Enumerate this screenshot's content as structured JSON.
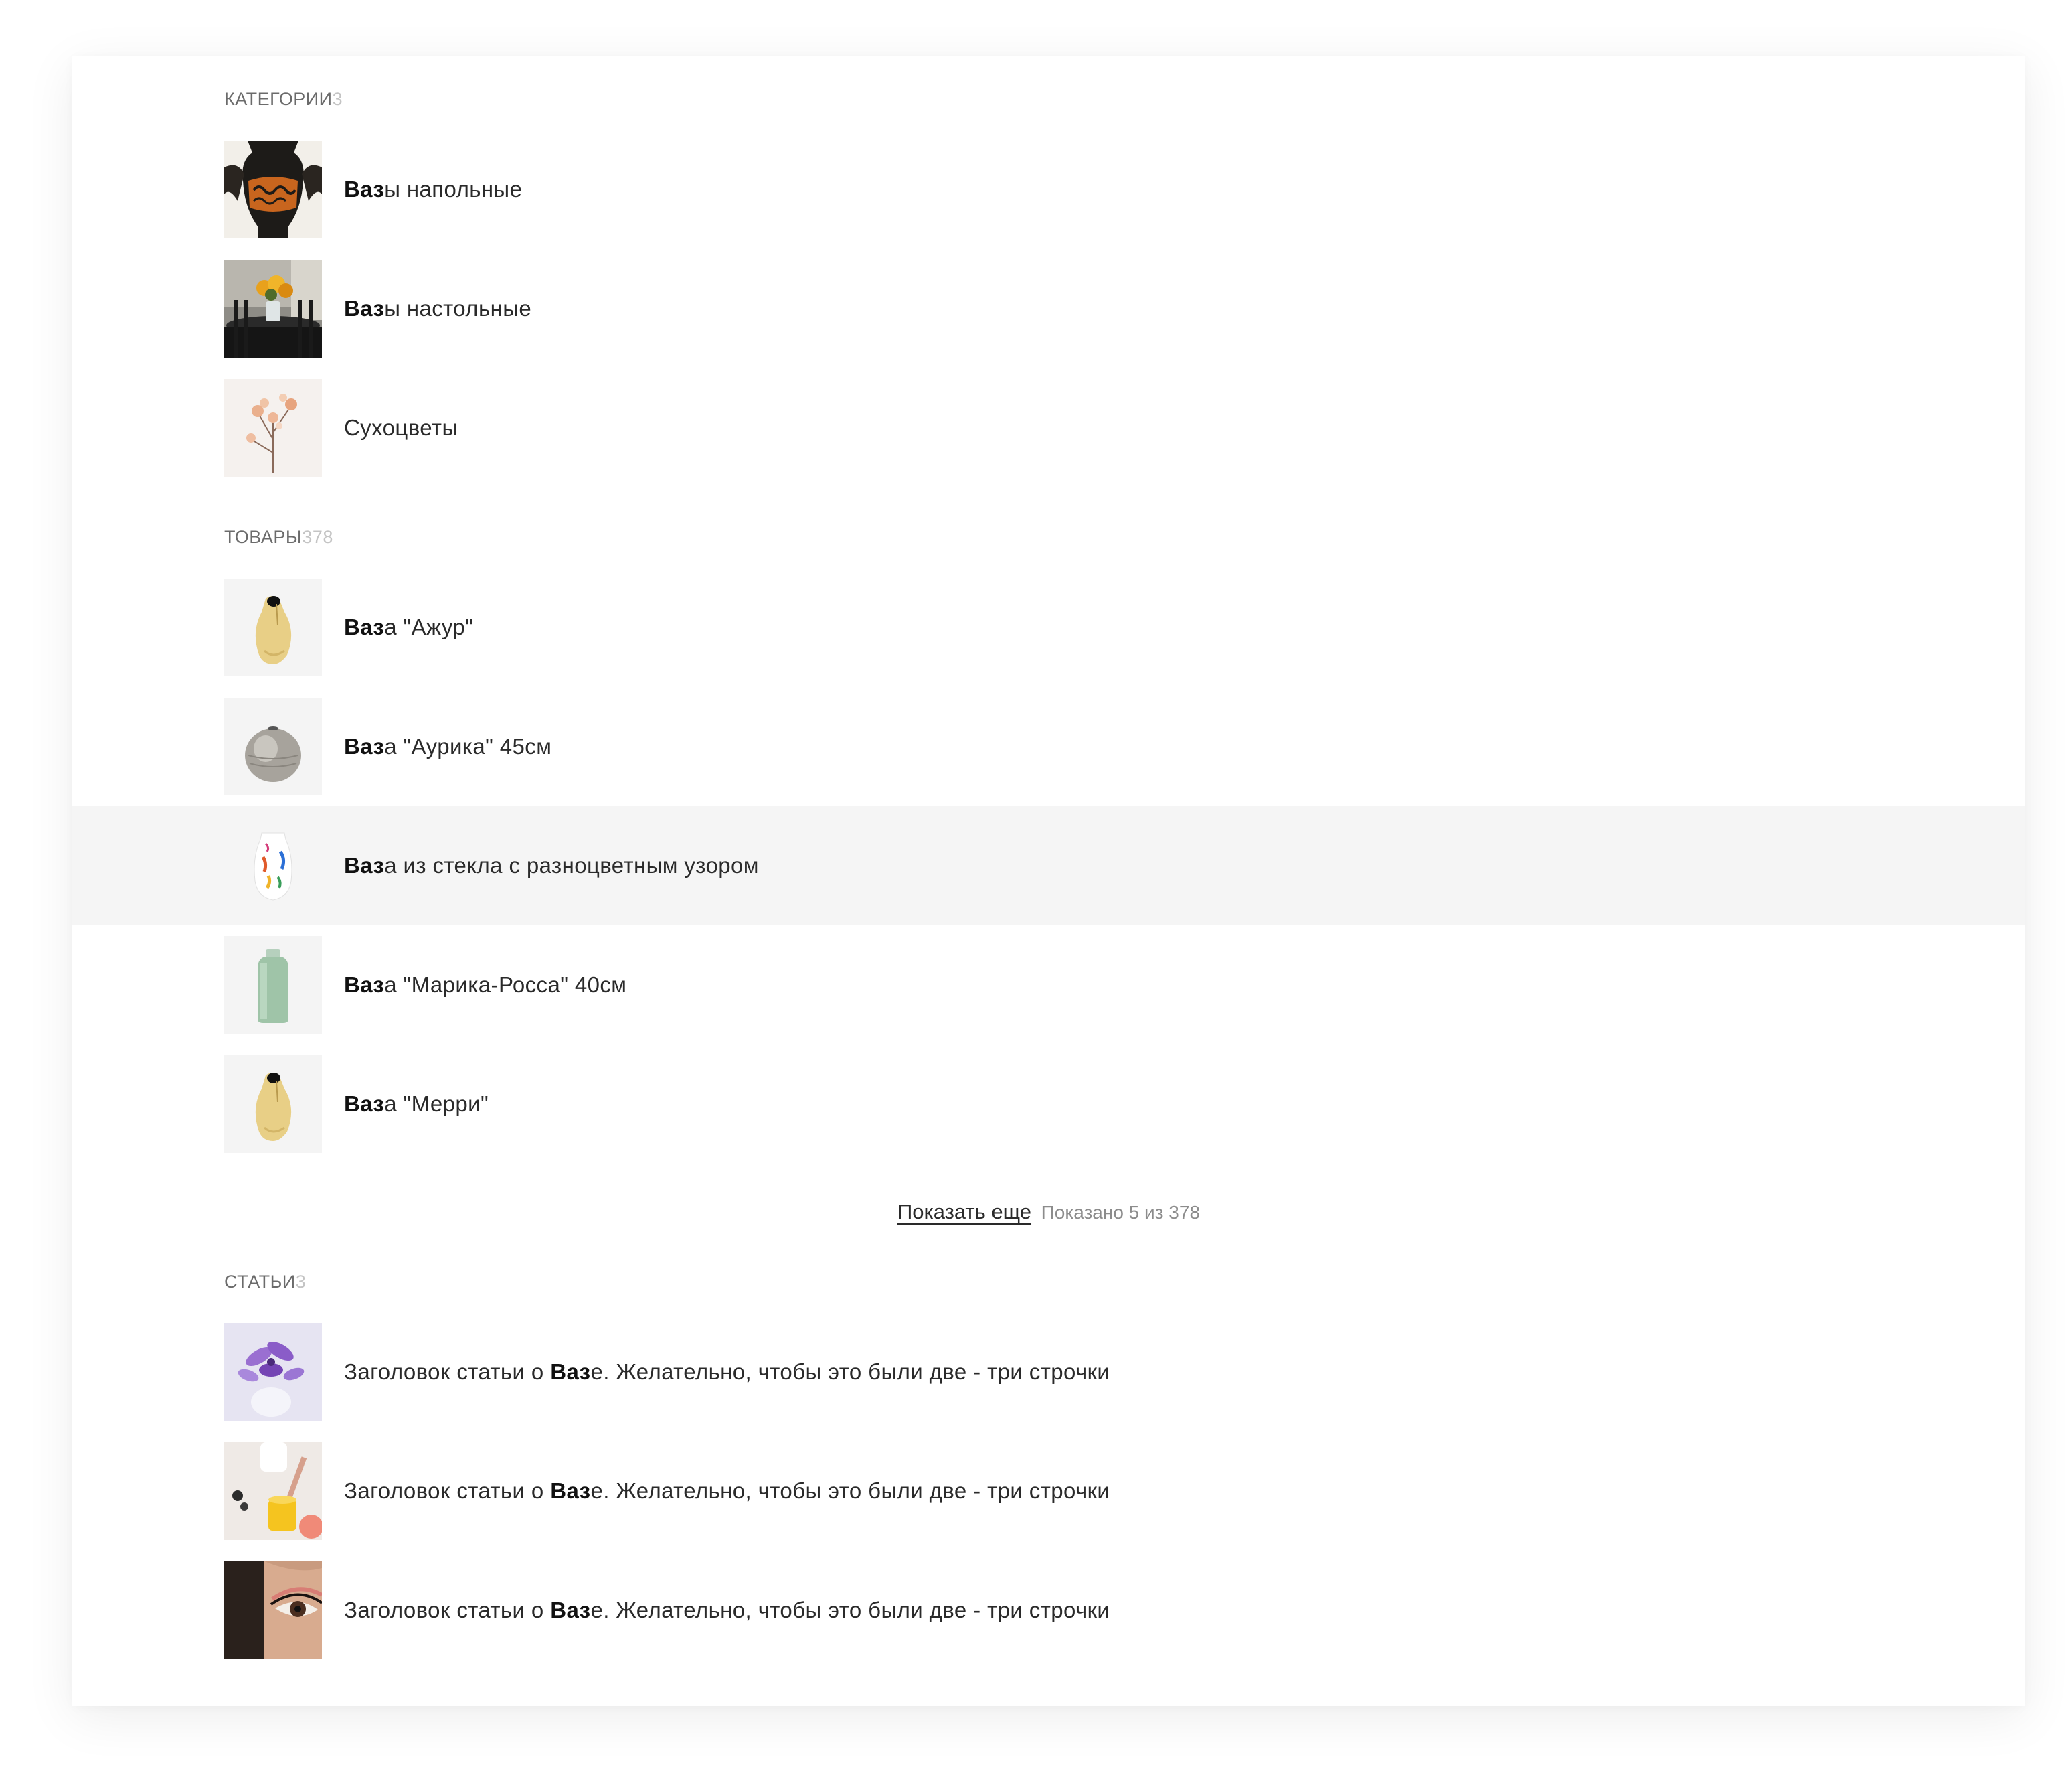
{
  "sections": {
    "categories": {
      "title": "Категории",
      "count": "3",
      "items": [
        {
          "pre": "",
          "match": "Ваз",
          "post": "ы напольные",
          "icon": "floor-vase-photo"
        },
        {
          "pre": "",
          "match": "Ваз",
          "post": "ы настольные",
          "icon": "table-vase-photo"
        },
        {
          "pre": "Сухоцветы",
          "match": "",
          "post": "",
          "icon": "dried-flowers-photo"
        }
      ]
    },
    "products": {
      "title": "Товары",
      "count": "378",
      "items": [
        {
          "pre": "",
          "match": "Ваз",
          "post": "а \"Ажур\"",
          "icon": "yellow-vase-photo"
        },
        {
          "pre": "",
          "match": "Ваз",
          "post": "а \"Аурика\" 45см",
          "icon": "silver-round-vase-photo"
        },
        {
          "pre": "",
          "match": "Ваз",
          "post": "а из стекла с разноцветным узором",
          "icon": "glass-patterned-vase-photo"
        },
        {
          "pre": "",
          "match": "Ваз",
          "post": "а \"Марика-Росса\" 40см",
          "icon": "green-tall-vase-photo"
        },
        {
          "pre": "",
          "match": "Ваз",
          "post": "а \"Мерри\"",
          "icon": "yellow-vase-photo"
        }
      ],
      "more_link": "Показать еще",
      "more_info": "Показано 5 из 378"
    },
    "articles": {
      "title": "Статьи",
      "count": "3",
      "items": [
        {
          "pre": "Заголовок статьи о ",
          "match": "Ваз",
          "post": "е. Желательно, чтобы это были две - три строчки",
          "icon": "orchid-photo"
        },
        {
          "pre": "Заголовок статьи о ",
          "match": "Ваз",
          "post": "е. Желательно, чтобы это были две - три строчки",
          "icon": "cosmetics-photo"
        },
        {
          "pre": "Заголовок статьи о ",
          "match": "Ваз",
          "post": "е. Желательно, чтобы это были две - три строчки",
          "icon": "eye-makeup-photo"
        }
      ]
    }
  },
  "highlight": {
    "section": "products",
    "index": 2,
    "color": "#f5f5f5"
  }
}
